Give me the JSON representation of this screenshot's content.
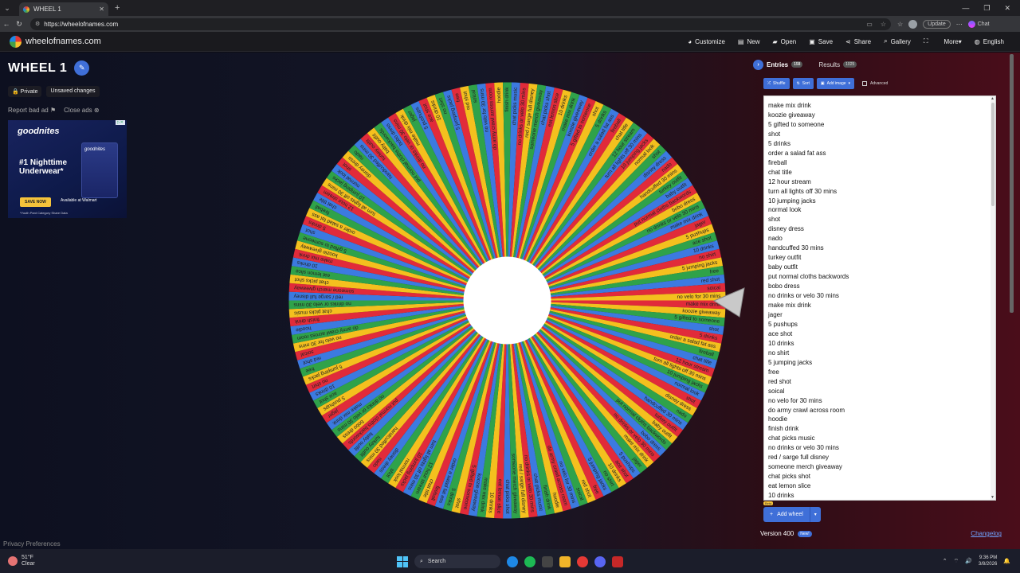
{
  "browser": {
    "tab_title": "WHEEL 1",
    "url": "https://wheelofnames.com",
    "update_label": "Update",
    "chat_label": "Chat"
  },
  "header": {
    "site_name": "wheelofnames.com",
    "menu": [
      {
        "icon": "palette-icon",
        "label": "Customize"
      },
      {
        "icon": "new-file-icon",
        "label": "New"
      },
      {
        "icon": "folder-icon",
        "label": "Open"
      },
      {
        "icon": "save-icon",
        "label": "Save"
      },
      {
        "icon": "share-icon",
        "label": "Share"
      },
      {
        "icon": "search-icon",
        "label": "Gallery"
      },
      {
        "icon": "fullscreen-icon",
        "label": ""
      },
      {
        "icon": "chevron-down-icon",
        "label": "More"
      },
      {
        "icon": "globe-icon",
        "label": "English"
      }
    ]
  },
  "wheel": {
    "title": "WHEEL 1",
    "privacy_chip": "Private",
    "unsaved_chip": "Unsaved changes",
    "report_ad": "Report bad ad",
    "close_ads": "Close ads",
    "segment_colors": [
      "#e12b3a",
      "#f4c01e",
      "#2fa24a",
      "#3c7ae0"
    ],
    "segment_count": 158,
    "hub_color": "#ffffff"
  },
  "ad": {
    "brand": "goodnites",
    "headline": "#1 Nighttime Underwear*",
    "cta": "SAVE NOW",
    "retailer": "Available at Walmart",
    "fine_print": "*Youth Pant Category Share Data"
  },
  "panel": {
    "entries_tab": "Entries",
    "entries_count": "158",
    "results_tab": "Results",
    "results_count": "1025",
    "shuffle": "Shuffle",
    "sort": "Sort",
    "add_image": "Add image",
    "advanced": "Advanced",
    "entries": [
      "make mix drink",
      "koozie giveaway",
      "5 gifted to someone",
      "shot",
      "5 drinks",
      "order a salad fat ass",
      "fireball",
      "chat title",
      "12 hour stream",
      "turn all lights off 30 mins",
      "10 jumping jacks",
      "normal look",
      "shot",
      "disney dress",
      "nado",
      "handcuffed 30 mins",
      "turkey outfit",
      "baby outfit",
      "put normal cloths backwords",
      "bobo dress",
      "no drinks or velo 30 mins",
      "make mix drink",
      "jager",
      "5 pushups",
      "ace shot",
      "10 drinks",
      "no shirt",
      "5 jumping jacks",
      "free",
      "red shot",
      "soical",
      "no velo for 30 mins",
      "do army crawl across room",
      "hoodie",
      "finish drink",
      "chat picks music",
      "no drinks or velo 30 mins",
      "red / sarge full disney",
      "someone merch giveaway",
      "chat picks shot",
      "eat lemon slice",
      "10 drinks"
    ],
    "beta_badge": "Beta",
    "add_wheel": "Add wheel",
    "version": "Version 400",
    "new_badge": "New!",
    "changelog": "Changelog"
  },
  "footer": {
    "privacy": "Privacy Preferences"
  },
  "taskbar": {
    "temp": "51°F",
    "weather": "Clear",
    "search": "Search",
    "time": "9:36 PM",
    "date": "3/8/2026"
  }
}
